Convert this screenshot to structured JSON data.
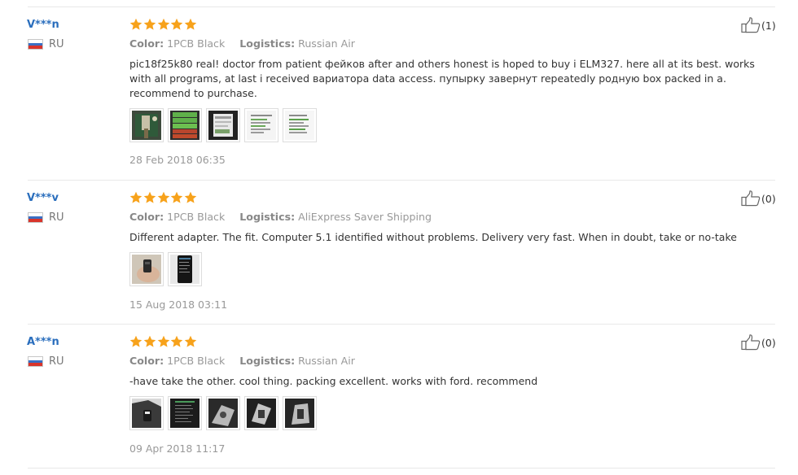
{
  "labels": {
    "color": "Color:",
    "logistics": "Logistics:"
  },
  "colors": {
    "star": "#f7a21b",
    "username": "#2a6ebd"
  },
  "icons": {
    "star": "star-icon",
    "like": "thumbs-up-icon",
    "flag": "russia-flag-icon"
  },
  "reviews": [
    {
      "user": "V***n",
      "country": "RU",
      "rating": 5,
      "color": "1PCB Black",
      "logistics": "Russian Air",
      "text": "pic18f25k80 real! doctor from patient фейков after and others honest is hoped to buy i ELM327. here all at its best. works with all programs, at last i received вариатора data access. пупырку завернут repeatedly родную box packed in a. recommend to purchase.",
      "helpful": "(1)",
      "date": "28 Feb 2018 06:35"
    },
    {
      "user": "V***v",
      "country": "RU",
      "rating": 5,
      "color": "1PCB Black",
      "logistics": "AliExpress Saver Shipping",
      "text": "Different adapter. The fit. Computer 5.1 identified without problems. Delivery very fast. When in doubt, take or no-take",
      "helpful": "(0)",
      "date": "15 Aug 2018 03:11"
    },
    {
      "user": "A***n",
      "country": "RU",
      "rating": 5,
      "color": "1PCB Black",
      "logistics": "Russian Air",
      "text": "-have take the other. cool thing. packing excellent. works with ford. recommend",
      "helpful": "(0)",
      "date": "09 Apr 2018 11:17"
    }
  ]
}
